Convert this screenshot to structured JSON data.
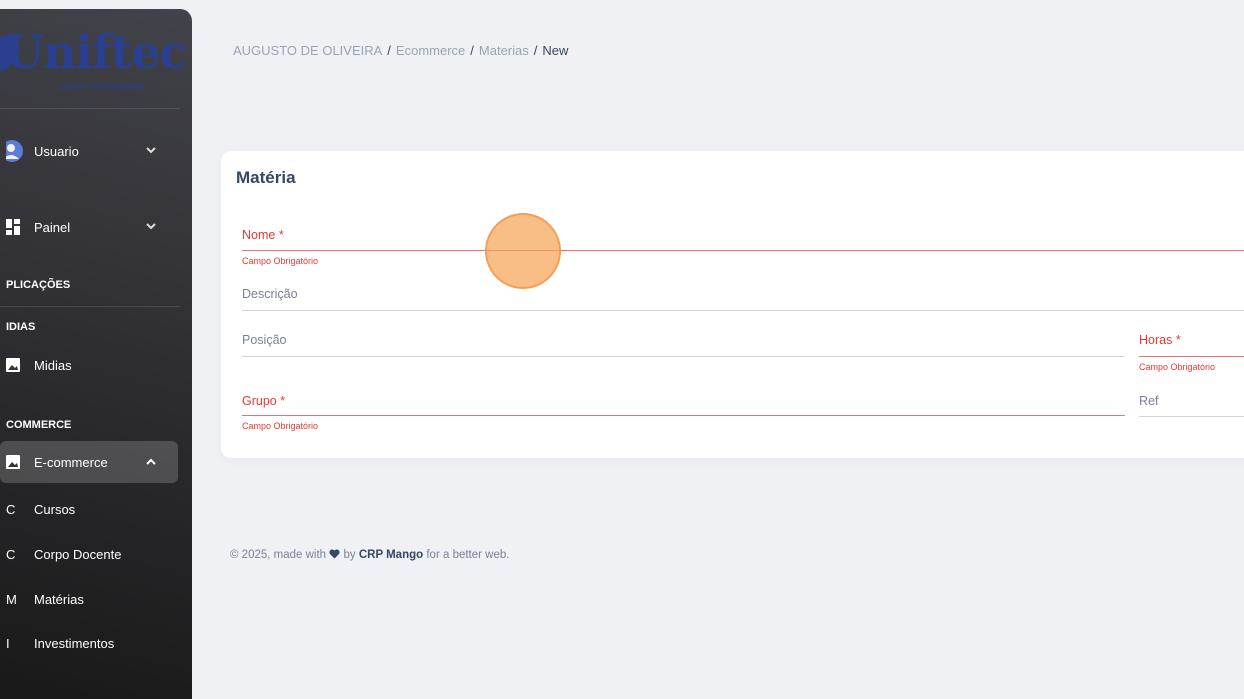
{
  "sidebar": {
    "logo": {
      "main": "Uniftec",
      "sub": "centro universitário"
    },
    "user_item": {
      "label": "Usuario"
    },
    "panel_item": {
      "label": "Painel"
    },
    "sections": {
      "aplicacoes": "PLICAÇÕES",
      "midias": "IDIAS",
      "ecommerce": "COMMERCE"
    },
    "midias_item": {
      "label": "Midias"
    },
    "ecommerce_item": {
      "label": "E-commerce"
    },
    "ecommerce_sub": [
      {
        "abbr": "C",
        "label": "Cursos"
      },
      {
        "abbr": "C",
        "label": "Corpo Docente"
      },
      {
        "abbr": "M",
        "label": "Matérias"
      },
      {
        "abbr": "I",
        "label": "Investimentos"
      }
    ]
  },
  "breadcrumb": {
    "items": [
      "AUGUSTO DE OLIVEIRA",
      "Ecommerce",
      "Materias"
    ],
    "separator": "/",
    "current": "New"
  },
  "form": {
    "title": "Matéria",
    "fields": {
      "nome": {
        "label": "Nome *",
        "helper": "Campo Obrigatório"
      },
      "descricao": {
        "label": "Descrição"
      },
      "posicao": {
        "label": "Posição"
      },
      "horas": {
        "label": "Horas *",
        "helper": "Campo Obrigatório"
      },
      "grupo": {
        "label": "Grupo *",
        "helper": "Campo Obrigatório"
      },
      "ref": {
        "label": "Ref"
      }
    }
  },
  "footer": {
    "prefix": "© 2025, made with",
    "by": "by",
    "brand": "CRP Mango",
    "suffix": "for a better web."
  },
  "colors": {
    "error": "#e53935",
    "sidebar_bg": "#191919",
    "page_bg": "#f0f1f5",
    "click_indicator": "#f7a358"
  }
}
